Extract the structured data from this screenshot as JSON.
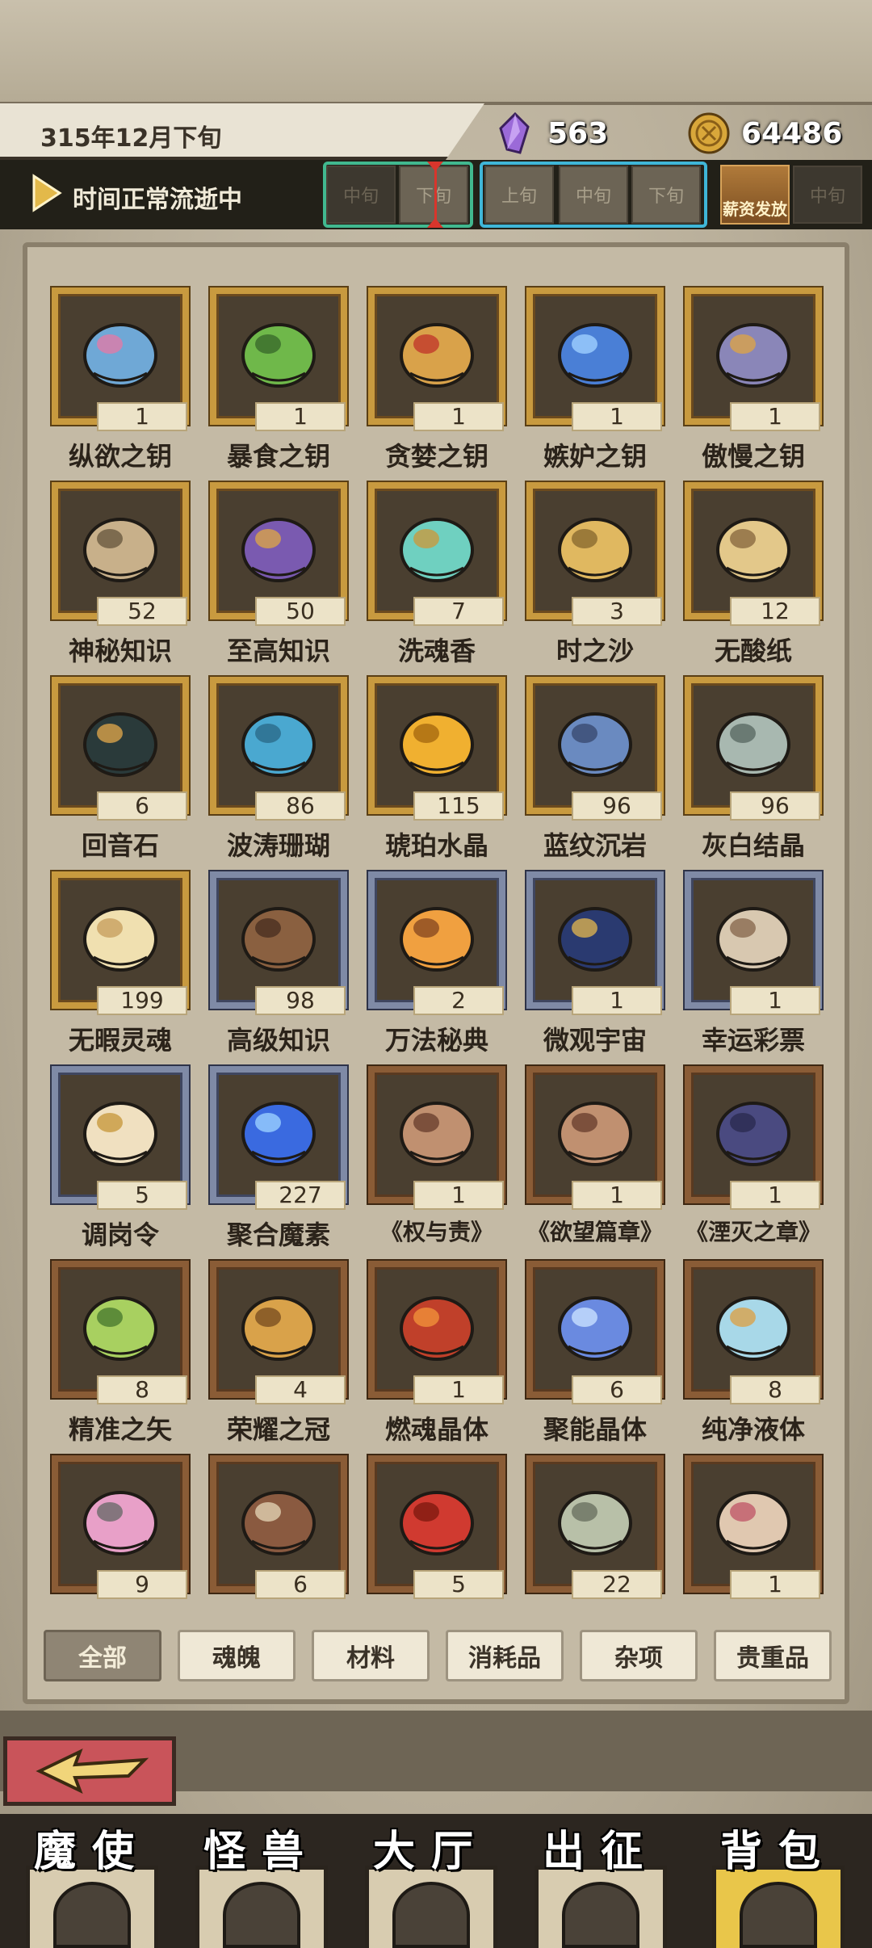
{
  "header": {
    "date": "315年12月下旬",
    "crystals": "563",
    "coins": "64486",
    "time_status": "时间正常流逝中",
    "slots": [
      "中旬",
      "下旬",
      "上旬",
      "中旬",
      "下旬",
      "中旬"
    ],
    "salary_label": "薪资发放"
  },
  "items": [
    {
      "name": "纵欲之钥",
      "count": "1",
      "frame": "gold",
      "icon": "heart-key-icon"
    },
    {
      "name": "暴食之钥",
      "count": "1",
      "frame": "gold",
      "icon": "green-key-icon"
    },
    {
      "name": "贪婪之钥",
      "count": "1",
      "frame": "gold",
      "icon": "golden-key-icon"
    },
    {
      "name": "嫉妒之钥",
      "count": "1",
      "frame": "gold",
      "icon": "blue-key-icon"
    },
    {
      "name": "傲慢之钥",
      "count": "1",
      "frame": "gold",
      "icon": "winged-key-icon"
    },
    {
      "name": "神秘知识",
      "count": "52",
      "frame": "gold",
      "icon": "stone-tablet-icon"
    },
    {
      "name": "至高知识",
      "count": "50",
      "frame": "gold",
      "icon": "purple-book-icon"
    },
    {
      "name": "洗魂香",
      "count": "7",
      "frame": "gold",
      "icon": "incense-lamp-icon"
    },
    {
      "name": "时之沙",
      "count": "3",
      "frame": "gold",
      "icon": "sand-swirl-icon"
    },
    {
      "name": "无酸纸",
      "count": "12",
      "frame": "gold",
      "icon": "scroll-icon"
    },
    {
      "name": "回音石",
      "count": "6",
      "frame": "gold",
      "icon": "echo-stone-icon"
    },
    {
      "name": "波涛珊瑚",
      "count": "86",
      "frame": "gold",
      "icon": "coral-icon"
    },
    {
      "name": "琥珀水晶",
      "count": "115",
      "frame": "gold",
      "icon": "amber-crystal-icon"
    },
    {
      "name": "蓝纹沉岩",
      "count": "96",
      "frame": "gold",
      "icon": "blue-rock-icon"
    },
    {
      "name": "灰白结晶",
      "count": "96",
      "frame": "gold",
      "icon": "grey-crystal-icon"
    },
    {
      "name": "无暇灵魂",
      "count": "199",
      "frame": "gold",
      "icon": "soul-icon"
    },
    {
      "name": "高级知识",
      "count": "98",
      "frame": "silver",
      "icon": "bound-book-icon"
    },
    {
      "name": "万法秘典",
      "count": "2",
      "frame": "silver",
      "icon": "flame-book-icon"
    },
    {
      "name": "微观宇宙",
      "count": "1",
      "frame": "silver",
      "icon": "cosmos-orb-icon"
    },
    {
      "name": "幸运彩票",
      "count": "1",
      "frame": "silver",
      "icon": "lottery-ticket-icon"
    },
    {
      "name": "调岗令",
      "count": "5",
      "frame": "silver",
      "icon": "order-paper-icon"
    },
    {
      "name": "聚合魔素",
      "count": "227",
      "frame": "silver",
      "icon": "magic-orb-icon"
    },
    {
      "name": "《权与责》",
      "count": "1",
      "frame": "bronze",
      "icon": "tome-icon"
    },
    {
      "name": "《欲望篇章》",
      "count": "1",
      "frame": "bronze",
      "icon": "tome-icon"
    },
    {
      "name": "《湮灭之章》",
      "count": "1",
      "frame": "bronze",
      "icon": "dark-tome-icon"
    },
    {
      "name": "精准之矢",
      "count": "8",
      "frame": "bronze",
      "icon": "arrow-icon"
    },
    {
      "name": "荣耀之冠",
      "count": "4",
      "frame": "bronze",
      "icon": "helmet-icon"
    },
    {
      "name": "燃魂晶体",
      "count": "1",
      "frame": "bronze",
      "icon": "fire-crystal-icon"
    },
    {
      "name": "聚能晶体",
      "count": "6",
      "frame": "bronze",
      "icon": "energy-crystal-icon"
    },
    {
      "name": "纯净液体",
      "count": "8",
      "frame": "bronze",
      "icon": "potion-icon"
    },
    {
      "name": "",
      "count": "9",
      "frame": "bronze",
      "icon": "pink-cloud-icon"
    },
    {
      "name": "",
      "count": "6",
      "frame": "bronze",
      "icon": "jar-icon"
    },
    {
      "name": "",
      "count": "5",
      "frame": "bronze",
      "icon": "red-crystal-icon"
    },
    {
      "name": "",
      "count": "22",
      "frame": "bronze",
      "icon": "rolled-scroll-icon"
    },
    {
      "name": "",
      "count": "1",
      "frame": "bronze",
      "icon": "open-book-icon"
    }
  ],
  "tabs": [
    "全部",
    "魂魄",
    "材料",
    "消耗品",
    "杂项",
    "贵重品"
  ],
  "nav": [
    "魔使",
    "怪兽",
    "大厅",
    "出征",
    "背包"
  ],
  "colors": {
    "gold_frame": "#c89a3f",
    "silver_frame": "#7f8aa6",
    "bronze_frame": "#8a5c36",
    "active_nav": "#e9c64a"
  }
}
